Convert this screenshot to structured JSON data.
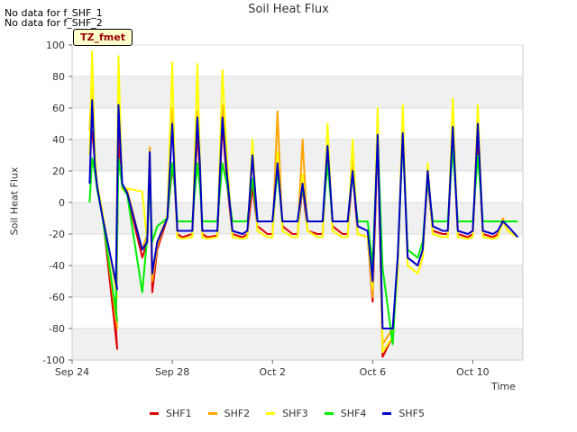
{
  "notes": [
    "No data for f_SHF_1",
    "No data for f_SHF_2"
  ],
  "badge": "TZ_fmet",
  "chart_data": {
    "type": "line",
    "title": "Soil Heat Flux",
    "xlabel": "Time",
    "ylabel": "Soil Heat Flux",
    "ylim": [
      -100,
      100
    ],
    "yticks": [
      -100,
      -80,
      -60,
      -40,
      -20,
      0,
      20,
      40,
      60,
      80,
      100
    ],
    "xlim": [
      0,
      18
    ],
    "xticks": [
      0,
      4,
      8,
      12,
      16
    ],
    "xtick_labels": [
      "Sep 24",
      "Sep 28",
      "Oct 2",
      "Oct 6",
      "Oct 10"
    ],
    "grid": true,
    "legend_position": "bottom",
    "colors": {
      "SHF1": "#e00000",
      "SHF2": "#ffa500",
      "SHF3": "#ffff00",
      "SHF4": "#00ee00",
      "SHF5": "#0000cc"
    },
    "series": [
      {
        "name": "SHF1",
        "x": [
          0.7,
          0.8,
          0.9,
          1.0,
          1.2,
          1.8,
          1.75,
          1.85,
          2.0,
          2.2,
          2.8,
          3.0,
          3.1,
          3.2,
          3.4,
          3.8,
          4.0,
          4.1,
          4.2,
          4.4,
          4.8,
          5.0,
          5.1,
          5.2,
          5.4,
          5.8,
          6.0,
          6.2,
          6.4,
          6.8,
          7.0,
          7.2,
          7.4,
          7.8,
          8.0,
          8.2,
          8.4,
          8.8,
          9.0,
          9.2,
          9.4,
          9.8,
          10.0,
          10.2,
          10.4,
          10.8,
          11.0,
          11.2,
          11.4,
          11.8,
          12.0,
          12.2,
          12.4,
          12.8,
          13.0,
          13.2,
          13.4,
          13.8,
          14.0,
          14.2,
          14.4,
          14.8,
          15.0,
          15.2,
          15.4,
          15.8,
          16.0,
          16.2,
          16.4,
          16.8,
          17.0,
          17.2,
          17.4,
          17.8
        ],
        "y": [
          40,
          45,
          28,
          10,
          -5,
          -93,
          -80,
          42,
          10,
          5,
          -35,
          -25,
          30,
          -57,
          -30,
          -10,
          22,
          10,
          -20,
          -22,
          -20,
          45,
          20,
          -20,
          -22,
          -21,
          50,
          10,
          -20,
          -22,
          -20,
          10,
          -15,
          -20,
          -20,
          28,
          -15,
          -20,
          -20,
          10,
          -18,
          -20,
          -20,
          35,
          -15,
          -20,
          -20,
          20,
          -20,
          -22,
          -63,
          42,
          -98,
          -85,
          -40,
          45,
          -35,
          -40,
          -30,
          15,
          -18,
          -20,
          -20,
          45,
          -20,
          -22,
          -20,
          40,
          -20,
          -22,
          -20,
          -12,
          -18,
          -22
        ]
      },
      {
        "name": "SHF2",
        "x": [
          0.7,
          0.8,
          0.9,
          1.0,
          1.2,
          1.8,
          1.75,
          1.85,
          2.0,
          2.2,
          2.8,
          3.0,
          3.1,
          3.2,
          3.4,
          3.8,
          4.0,
          4.1,
          4.2,
          4.4,
          4.8,
          5.0,
          5.1,
          5.2,
          5.4,
          5.8,
          6.0,
          6.2,
          6.4,
          6.8,
          7.0,
          7.2,
          7.4,
          7.8,
          8.0,
          8.2,
          8.4,
          8.8,
          9.0,
          9.2,
          9.4,
          9.8,
          10.0,
          10.2,
          10.4,
          10.8,
          11.0,
          11.2,
          11.4,
          11.8,
          12.0,
          12.2,
          12.4,
          12.8,
          13.0,
          13.2,
          13.4,
          13.8,
          14.0,
          14.2,
          14.4,
          14.8,
          15.0,
          15.2,
          15.4,
          15.8,
          16.0,
          16.2,
          16.4,
          16.8,
          17.0,
          17.2,
          17.4,
          17.8
        ],
        "y": [
          45,
          82,
          30,
          10,
          -5,
          -80,
          -70,
          70,
          10,
          8,
          -30,
          -20,
          35,
          -50,
          -28,
          -8,
          60,
          15,
          -22,
          -23,
          -22,
          58,
          25,
          -22,
          -23,
          -22,
          62,
          20,
          -22,
          -23,
          -22,
          30,
          -18,
          -22,
          -22,
          58,
          -18,
          -22,
          -22,
          40,
          -18,
          -22,
          -22,
          40,
          -18,
          -22,
          -22,
          30,
          -20,
          -22,
          -60,
          55,
          -90,
          -80,
          -45,
          55,
          -40,
          -45,
          -35,
          20,
          -20,
          -22,
          -22,
          60,
          -22,
          -23,
          -22,
          58,
          -22,
          -23,
          -22,
          -10,
          -18,
          -22
        ]
      },
      {
        "name": "SHF3",
        "x": [
          0.7,
          0.8,
          0.9,
          1.0,
          1.2,
          1.8,
          1.75,
          1.85,
          2.0,
          2.2,
          2.8,
          3.0,
          3.1,
          3.2,
          3.4,
          3.8,
          4.0,
          4.1,
          4.2,
          4.4,
          4.8,
          5.0,
          5.1,
          5.2,
          5.4,
          5.8,
          6.0,
          6.2,
          6.4,
          6.8,
          7.0,
          7.2,
          7.4,
          7.8,
          8.0,
          8.2,
          8.4,
          8.8,
          9.0,
          9.2,
          9.4,
          9.8,
          10.0,
          10.2,
          10.4,
          10.8,
          11.0,
          11.2,
          11.4,
          11.8,
          12.0,
          12.2,
          12.4,
          12.8,
          13.0,
          13.2,
          13.4,
          13.8,
          14.0,
          14.2,
          14.4,
          14.8,
          15.0,
          15.2,
          15.4,
          15.8,
          16.0,
          16.2,
          16.4,
          16.8,
          17.0,
          17.2,
          17.4,
          17.8
        ],
        "y": [
          30,
          96,
          35,
          12,
          -5,
          -60,
          -55,
          93,
          8,
          9,
          7,
          -25,
          30,
          -45,
          -25,
          -8,
          89,
          20,
          -22,
          -23,
          -22,
          88,
          30,
          -22,
          -23,
          -22,
          84,
          25,
          -22,
          -23,
          -22,
          40,
          -18,
          -22,
          -22,
          32,
          -18,
          -22,
          -22,
          18,
          -18,
          -22,
          -22,
          50,
          -18,
          -22,
          -22,
          40,
          -20,
          -22,
          -55,
          60,
          -95,
          -85,
          -45,
          62,
          -40,
          -45,
          -35,
          25,
          -20,
          -22,
          -22,
          66,
          -22,
          -23,
          -22,
          62,
          -22,
          -23,
          -22,
          -12,
          -18,
          -22
        ]
      },
      {
        "name": "SHF4",
        "x": [
          0.7,
          0.8,
          0.9,
          1.0,
          1.2,
          1.8,
          1.75,
          1.85,
          2.0,
          2.2,
          2.8,
          3.0,
          3.1,
          3.2,
          3.4,
          3.8,
          4.0,
          4.1,
          4.2,
          4.4,
          4.8,
          5.0,
          5.1,
          5.2,
          5.4,
          5.8,
          6.0,
          6.2,
          6.4,
          6.8,
          7.0,
          7.2,
          7.4,
          7.8,
          8.0,
          8.2,
          8.4,
          8.8,
          9.0,
          9.2,
          9.4,
          9.8,
          10.0,
          10.2,
          10.4,
          10.8,
          11.0,
          11.2,
          11.4,
          11.8,
          12.0,
          12.2,
          12.4,
          12.8,
          13.0,
          13.2,
          13.4,
          13.8,
          14.0,
          14.2,
          14.4,
          14.8,
          15.0,
          15.2,
          15.4,
          15.8,
          16.0,
          16.2,
          16.4,
          16.8,
          17.0,
          17.2,
          17.4,
          17.8
        ],
        "y": [
          0,
          28,
          20,
          8,
          -8,
          -75,
          -70,
          28,
          10,
          5,
          -57,
          -22,
          12,
          -25,
          -15,
          -10,
          25,
          10,
          -12,
          -12,
          -12,
          25,
          10,
          -12,
          -12,
          -12,
          25,
          10,
          -12,
          -12,
          -12,
          15,
          -12,
          -12,
          -12,
          20,
          -12,
          -12,
          -12,
          10,
          -12,
          -12,
          -12,
          25,
          -12,
          -12,
          -12,
          18,
          -12,
          -12,
          -40,
          40,
          -42,
          -90,
          -35,
          40,
          -30,
          -35,
          -25,
          15,
          -12,
          -12,
          -12,
          35,
          -12,
          -12,
          -12,
          30,
          -12,
          -12,
          -12,
          -12,
          -12,
          -12
        ]
      },
      {
        "name": "SHF5",
        "x": [
          0.7,
          0.8,
          0.9,
          1.0,
          1.2,
          1.8,
          1.75,
          1.85,
          2.0,
          2.2,
          2.8,
          3.0,
          3.1,
          3.2,
          3.4,
          3.8,
          4.0,
          4.1,
          4.2,
          4.4,
          4.8,
          5.0,
          5.1,
          5.2,
          5.4,
          5.8,
          6.0,
          6.2,
          6.4,
          6.8,
          7.0,
          7.2,
          7.4,
          7.8,
          8.0,
          8.2,
          8.4,
          8.8,
          9.0,
          9.2,
          9.4,
          9.8,
          10.0,
          10.2,
          10.4,
          10.8,
          11.0,
          11.2,
          11.4,
          11.8,
          12.0,
          12.2,
          12.4,
          12.8,
          13.0,
          13.2,
          13.4,
          13.8,
          14.0,
          14.2,
          14.4,
          14.8,
          15.0,
          15.2,
          15.4,
          15.8,
          16.0,
          16.2,
          16.4,
          16.8,
          17.0,
          17.2,
          17.4,
          17.8
        ],
        "y": [
          12,
          65,
          25,
          10,
          -8,
          -55,
          -50,
          62,
          12,
          6,
          -30,
          -25,
          32,
          -45,
          -25,
          -10,
          50,
          15,
          -18,
          -18,
          -18,
          54,
          25,
          -18,
          -18,
          -18,
          54,
          15,
          -18,
          -20,
          -18,
          30,
          -12,
          -12,
          -12,
          25,
          -12,
          -12,
          -12,
          12,
          -12,
          -12,
          -12,
          36,
          -12,
          -12,
          -12,
          20,
          -15,
          -18,
          -50,
          43,
          -80,
          -80,
          -35,
          44,
          -35,
          -40,
          -30,
          20,
          -15,
          -18,
          -18,
          48,
          -18,
          -20,
          -18,
          50,
          -18,
          -20,
          -18,
          -12,
          -15,
          -22
        ]
      }
    ]
  }
}
